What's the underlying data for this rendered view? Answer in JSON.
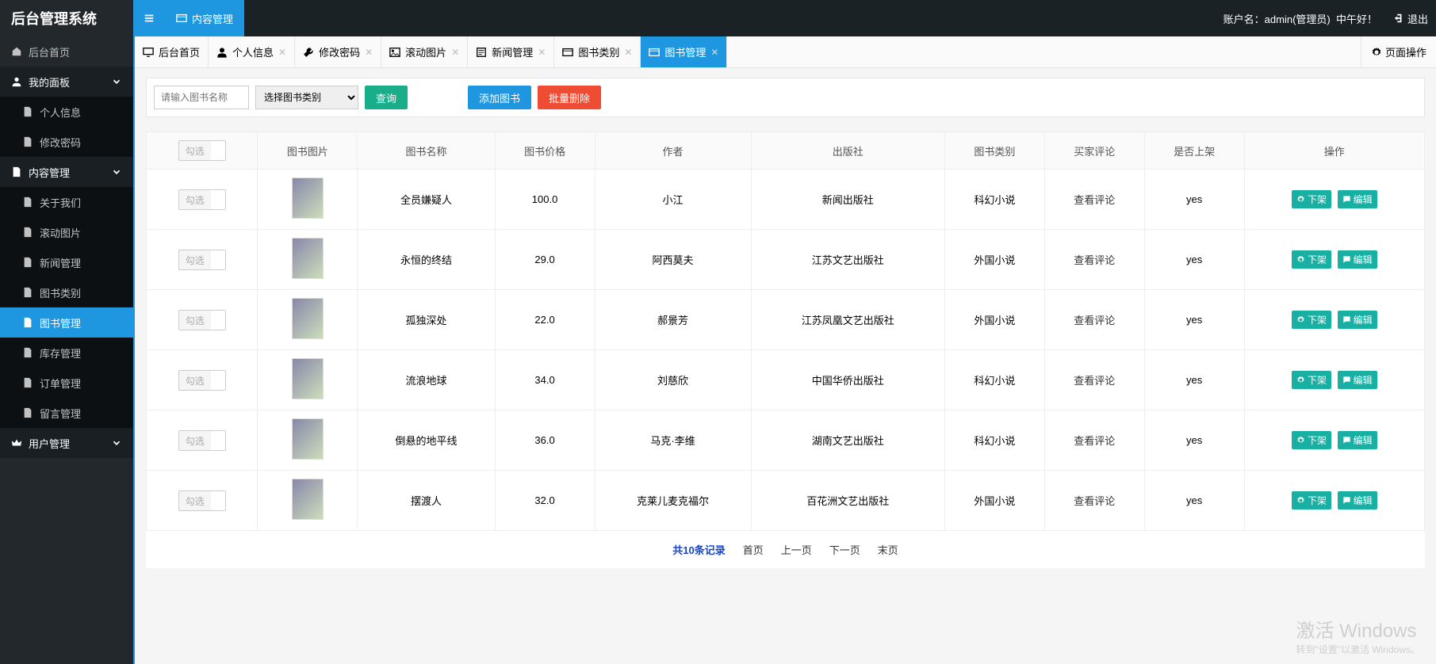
{
  "header": {
    "brand": "后台管理系统",
    "topTabLabel": "内容管理",
    "accountLabel": "账户名：",
    "account": "admin(管理员)",
    "greeting": "中午好！",
    "logoutLabel": "退出"
  },
  "sidebar": {
    "home": "后台首页",
    "groups": [
      {
        "label": "我的面板",
        "icon": "user",
        "items": [
          "个人信息",
          "修改密码"
        ]
      },
      {
        "label": "内容管理",
        "icon": "doc",
        "items": [
          "关于我们",
          "滚动图片",
          "新闻管理",
          "图书类别",
          "图书管理",
          "库存管理",
          "订单管理",
          "留言管理"
        ],
        "active": "图书管理"
      },
      {
        "label": "用户管理",
        "icon": "crown",
        "items": []
      }
    ]
  },
  "tabs": {
    "items": [
      {
        "label": "后台首页",
        "icon": "monitor",
        "closable": false
      },
      {
        "label": "个人信息",
        "icon": "user-edit",
        "closable": true
      },
      {
        "label": "修改密码",
        "icon": "wrench",
        "closable": true
      },
      {
        "label": "滚动图片",
        "icon": "image",
        "closable": true
      },
      {
        "label": "新闻管理",
        "icon": "news",
        "closable": true
      },
      {
        "label": "图书类别",
        "icon": "card",
        "closable": true
      },
      {
        "label": "图书管理",
        "icon": "card",
        "closable": true,
        "active": true
      }
    ],
    "refreshLabel": "页面操作"
  },
  "toolbar": {
    "searchPlaceholder": "请输入图书名称",
    "categorySelect": "选择图书类别",
    "queryLabel": "查询",
    "addLabel": "添加图书",
    "batchDeleteLabel": "批量删除"
  },
  "table": {
    "selectLabel": "勾选",
    "headers": [
      "图书图片",
      "图书名称",
      "图书价格",
      "作者",
      "出版社",
      "图书类别",
      "买家评论",
      "是否上架",
      "操作"
    ],
    "commentLabel": "查看评论",
    "offShelfLabel": "下架",
    "editLabel": "编辑",
    "rows": [
      {
        "name": "全员嫌疑人",
        "price": "100.0",
        "author": "小江",
        "publisher": "新闻出版社",
        "category": "科幻小说",
        "onShelf": "yes"
      },
      {
        "name": "永恒的终结",
        "price": "29.0",
        "author": "阿西莫夫",
        "publisher": "江苏文艺出版社",
        "category": "外国小说",
        "onShelf": "yes"
      },
      {
        "name": "孤独深处",
        "price": "22.0",
        "author": "郝景芳",
        "publisher": "江苏凤凰文艺出版社",
        "category": "外国小说",
        "onShelf": "yes"
      },
      {
        "name": "流浪地球",
        "price": "34.0",
        "author": "刘慈欣",
        "publisher": "中国华侨出版社",
        "category": "科幻小说",
        "onShelf": "yes"
      },
      {
        "name": "倒悬的地平线",
        "price": "36.0",
        "author": "马克·李维",
        "publisher": "湖南文艺出版社",
        "category": "科幻小说",
        "onShelf": "yes"
      },
      {
        "name": "摆渡人",
        "price": "32.0",
        "author": "克莱儿麦克福尔",
        "publisher": "百花洲文艺出版社",
        "category": "外国小说",
        "onShelf": "yes"
      }
    ]
  },
  "pager": {
    "total": "共10条记录",
    "first": "首页",
    "prev": "上一页",
    "next": "下一页",
    "last": "末页"
  },
  "watermark": {
    "l1": "激活 Windows",
    "l2": "转到\"设置\"以激活 Windows。"
  }
}
